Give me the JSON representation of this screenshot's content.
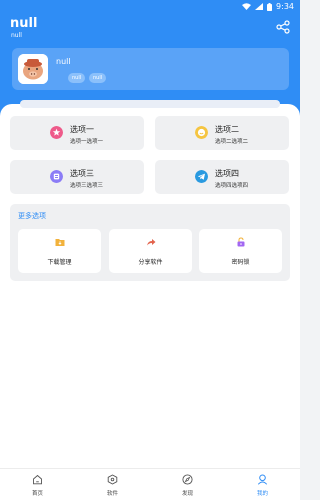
{
  "status_bar": {
    "time": "9:34"
  },
  "header": {
    "title": "null",
    "subtitle": "null"
  },
  "profile": {
    "name": "null",
    "tags": [
      "null",
      "null"
    ]
  },
  "options": [
    {
      "title": "选项一",
      "desc": "选项一选项一",
      "icon": "star-icon",
      "color": "#ee5a8a"
    },
    {
      "title": "选项二",
      "desc": "选项二选项二",
      "icon": "smile-icon",
      "color": "#f5c542"
    },
    {
      "title": "选项三",
      "desc": "选项三选项三",
      "icon": "box-icon",
      "color": "#8b7cf6"
    },
    {
      "title": "选项四",
      "desc": "选项四选项四",
      "icon": "telegram-icon",
      "color": "#2a9ae0"
    }
  ],
  "more": {
    "title": "更多选项",
    "items": [
      {
        "label": "下载管理",
        "icon": "download-folder-icon",
        "color": "#f2b23b"
      },
      {
        "label": "分享软件",
        "icon": "share-arrow-icon",
        "color": "#e2634c"
      },
      {
        "label": "密码锁",
        "icon": "lock-icon",
        "color": "#a267f2"
      }
    ]
  },
  "bottom_nav": [
    {
      "label": "首页",
      "icon": "home-icon"
    },
    {
      "label": "软件",
      "icon": "app-icon"
    },
    {
      "label": "发现",
      "icon": "compass-icon"
    },
    {
      "label": "我的",
      "icon": "person-icon",
      "active": true
    }
  ],
  "colors": {
    "accent": "#2f8df5"
  }
}
